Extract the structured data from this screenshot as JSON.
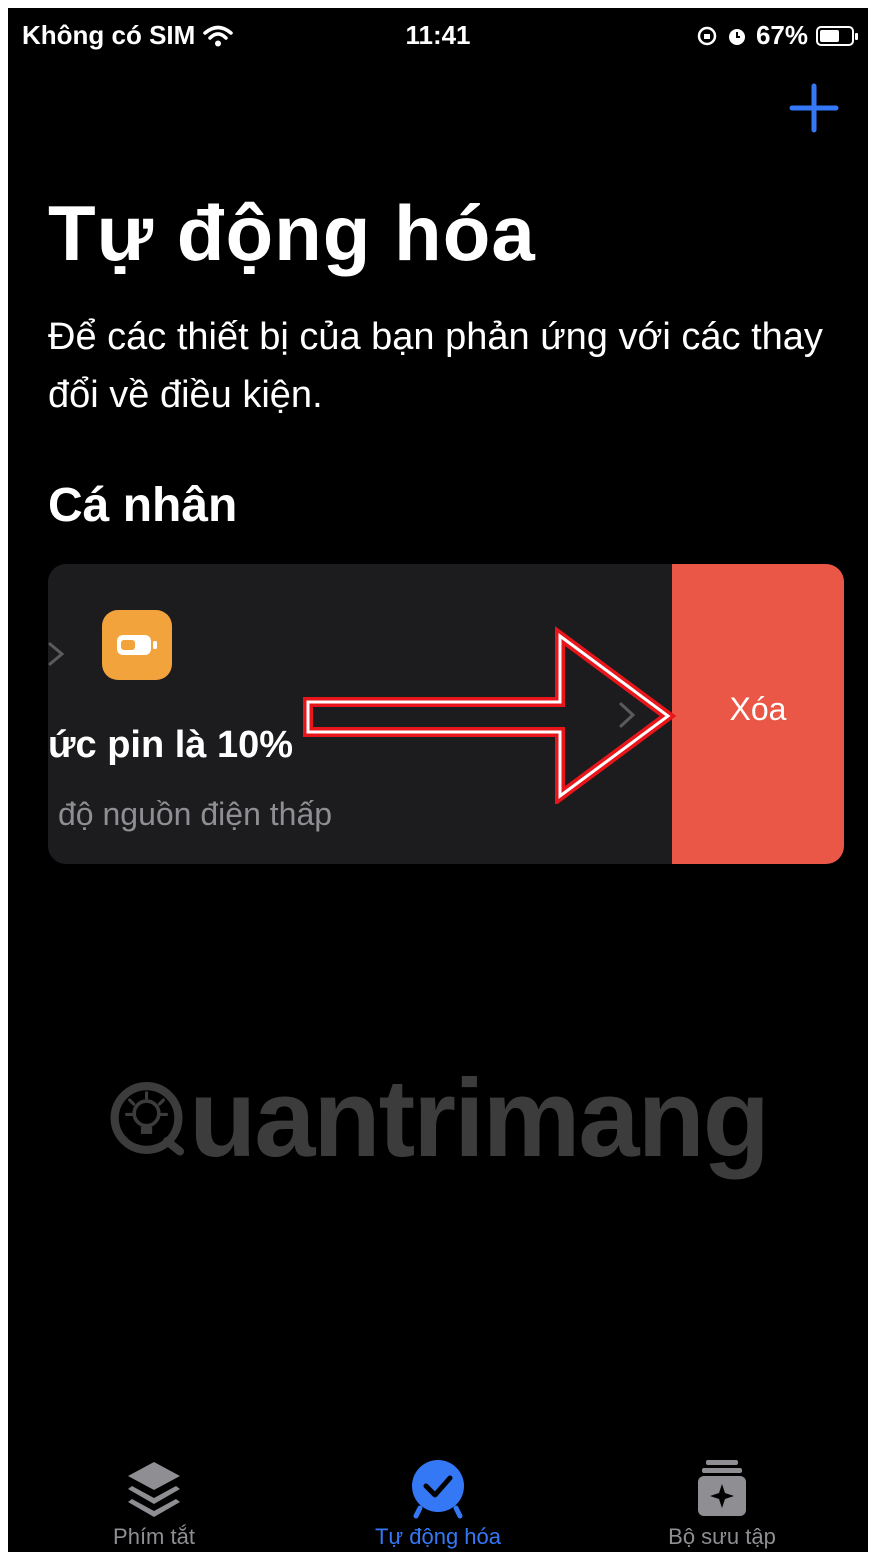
{
  "status_bar": {
    "carrier": "Không có SIM",
    "time": "11:41",
    "battery_percent": "67%",
    "battery_level": 0.67
  },
  "header": {
    "add_icon": "plus-icon",
    "title": "Tự động hóa",
    "subtitle": "Để các thiết bị của bạn phản ứng với các thay đổi về điều kiện."
  },
  "section": {
    "title": "Cá nhân"
  },
  "automation_card": {
    "icon": "battery-icon",
    "title": "ức pin là 10%",
    "subtitle": "độ nguồn điện thấp",
    "delete_label": "Xóa"
  },
  "watermark": {
    "text": "uantrimang"
  },
  "tabs": [
    {
      "label": "Phím tắt",
      "icon": "layers-icon",
      "active": false
    },
    {
      "label": "Tự động hóa",
      "icon": "clock-check-icon",
      "active": true
    },
    {
      "label": "Bộ sưu tập",
      "icon": "gallery-icon",
      "active": false
    }
  ],
  "colors": {
    "background": "#000000",
    "accent": "#3478f6",
    "delete": "#ea5747",
    "app_icon": "#f2a33c",
    "annotation_arrow": "#e8161b"
  }
}
